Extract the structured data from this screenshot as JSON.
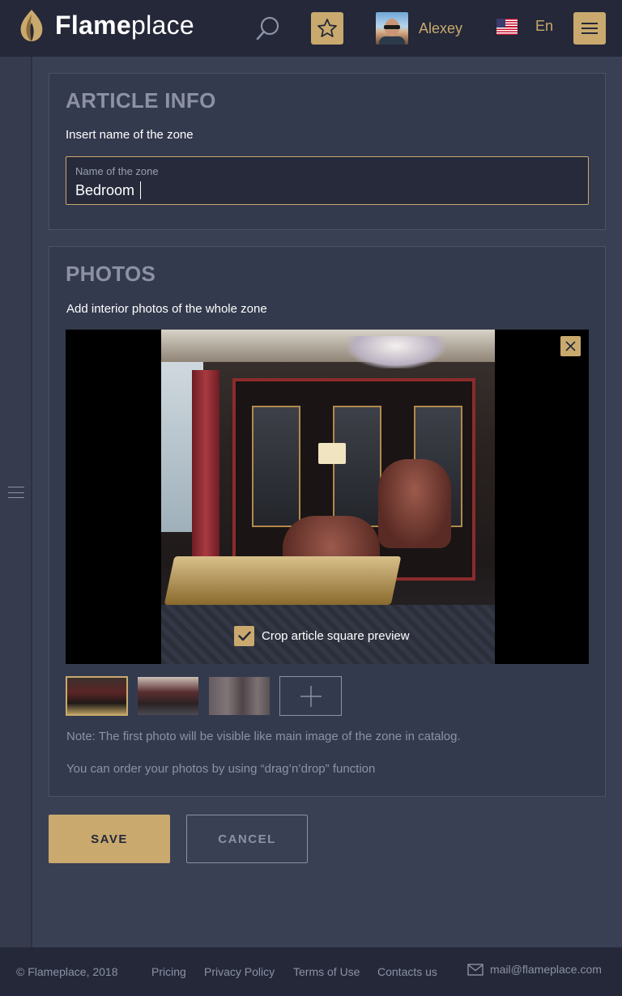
{
  "header": {
    "logo_bold": "Flame",
    "logo_light": "place",
    "user_name": "Alexey",
    "language": "En",
    "icons": {
      "logo": "flame-logo-icon",
      "search": "search-icon",
      "favorites": "star-icon",
      "avatar": "avatar",
      "flag": "us-flag-icon",
      "menu": "hamburger-menu-icon"
    }
  },
  "article_info": {
    "title": "ARTICLE INFO",
    "subtitle": "Insert name of the zone",
    "zone_field": {
      "label": "Name of the zone",
      "value": "Bedroom"
    }
  },
  "photos": {
    "title": "PHOTOS",
    "subtitle": "Add interior photos of the whole zone",
    "crop_label": "Crop article square preview",
    "crop_checked": true,
    "thumbnail_count": 3,
    "note_1": "Note: The first photo will be visible like main image of the zone in catalog.",
    "note_2": "You can order your photos by using “drag’n’drop” function"
  },
  "actions": {
    "save_label": "SAVE",
    "cancel_label": "CANCEL"
  },
  "footer": {
    "copyright": "© Flameplace, 2018",
    "links": [
      "Pricing",
      "Privacy Policy",
      "Terms of Use",
      "Contacts us"
    ],
    "email": "mail@flameplace.com"
  },
  "colors": {
    "accent": "#c9a96e",
    "header_bg": "#242838",
    "page_bg": "#3a4054",
    "card_bg": "#343a4d",
    "muted_text": "#8c92a6"
  }
}
